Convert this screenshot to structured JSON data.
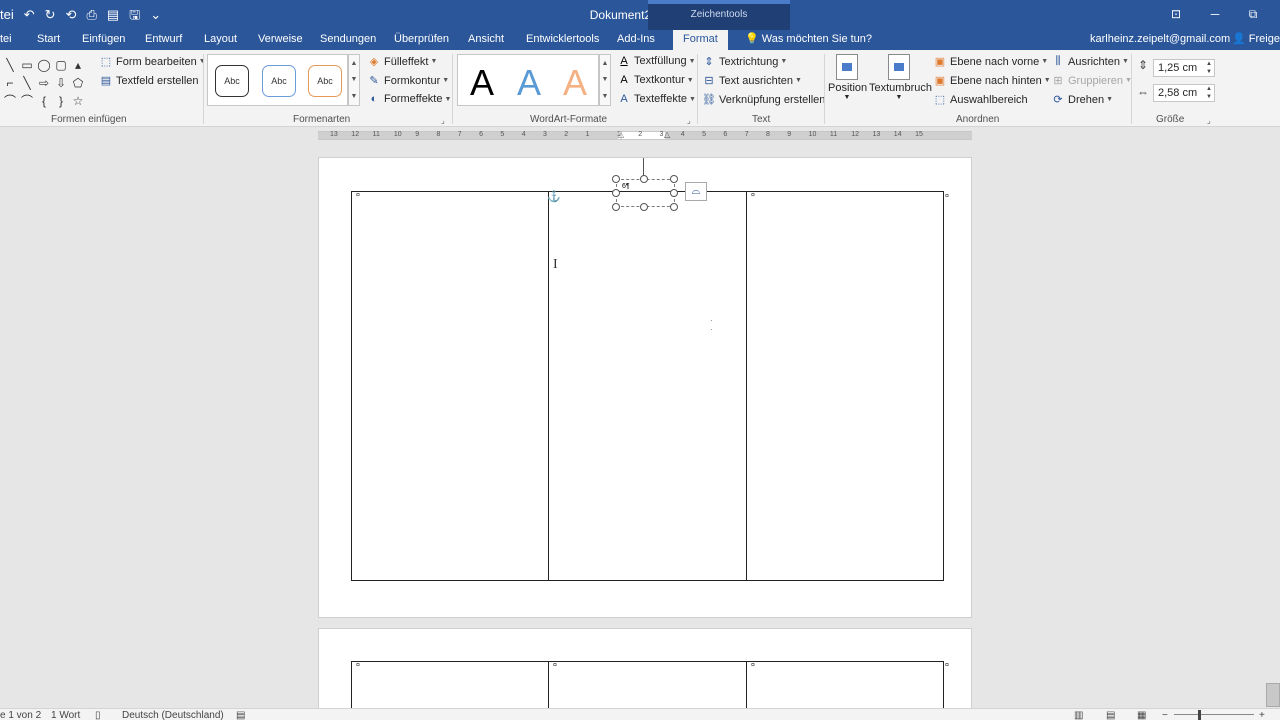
{
  "titlebar": {
    "doc_title": "Dokument2 - Word",
    "context_group": "Zeichentools",
    "qat": [
      "tei",
      "↶",
      "↻",
      "⟲",
      "⎙",
      "▤",
      "🖫",
      "⌄"
    ],
    "win_controls": [
      "⊡",
      "─",
      "⧉"
    ]
  },
  "tabs": {
    "items": [
      "tei",
      "Start",
      "Einfügen",
      "Entwurf",
      "Layout",
      "Verweise",
      "Sendungen",
      "Überprüfen",
      "Ansicht",
      "Entwicklertools",
      "Add-Ins"
    ],
    "active": "Format",
    "tell_me": "Was möchten Sie tun?",
    "account": "karlheinz.zeipelt@gmail.com",
    "share": "Freigeb"
  },
  "ribbon": {
    "formen_einfuegen": {
      "label": "Formen einfügen",
      "edit_shape": "Form bearbeiten",
      "textbox": "Textfeld erstellen",
      "shapes": [
        "╲",
        "▭",
        "◯",
        "▢",
        "",
        "⌐",
        "╲",
        "⇨",
        "⇩",
        "⬠",
        "⌒",
        "⌒",
        "{",
        "}",
        "☆"
      ]
    },
    "formenarten": {
      "label": "Formenarten",
      "styles": [
        "Abc",
        "Abc",
        "Abc"
      ],
      "fill": "Fülleffekt",
      "outline": "Formkontur",
      "effects": "Formeffekte"
    },
    "wordart": {
      "label": "WordArt-Formate",
      "letters": [
        "A",
        "A",
        "A"
      ],
      "text_fill": "Textfüllung",
      "text_outline": "Textkontur",
      "text_effects": "Texteffekte"
    },
    "text": {
      "label": "Text",
      "direction": "Textrichtung",
      "align": "Text ausrichten",
      "link": "Verknüpfung erstellen"
    },
    "anordnen": {
      "label": "Anordnen",
      "position": "Position",
      "wrap": "Textumbruch",
      "forward": "Ebene nach vorne",
      "backward": "Ebene nach hinten",
      "selection": "Auswahlbereich",
      "align": "Ausrichten",
      "group": "Gruppieren",
      "rotate": "Drehen"
    },
    "groesse": {
      "label": "Größe",
      "height": "1,25 cm",
      "width": "2,58 cm"
    }
  },
  "ruler": {
    "ticks": [
      "13",
      "12",
      "11",
      "10",
      "9",
      "8",
      "7",
      "6",
      "5",
      "4",
      "3",
      "2",
      "1",
      "1",
      "2",
      "3",
      "4",
      "5",
      "6",
      "7",
      "8",
      "9",
      "10",
      "11",
      "12",
      "13",
      "14",
      "15"
    ]
  },
  "document": {
    "textbox_text": "6¶",
    "cell_mark": "¤"
  },
  "status": {
    "page": "e 1 von 2",
    "words": "1 Wort",
    "language": "Deutsch (Deutschland)"
  },
  "colors": {
    "accent": "#2b579a",
    "ribbon_bg": "#f3f3f3",
    "canvas_bg": "#e6e6e6"
  }
}
